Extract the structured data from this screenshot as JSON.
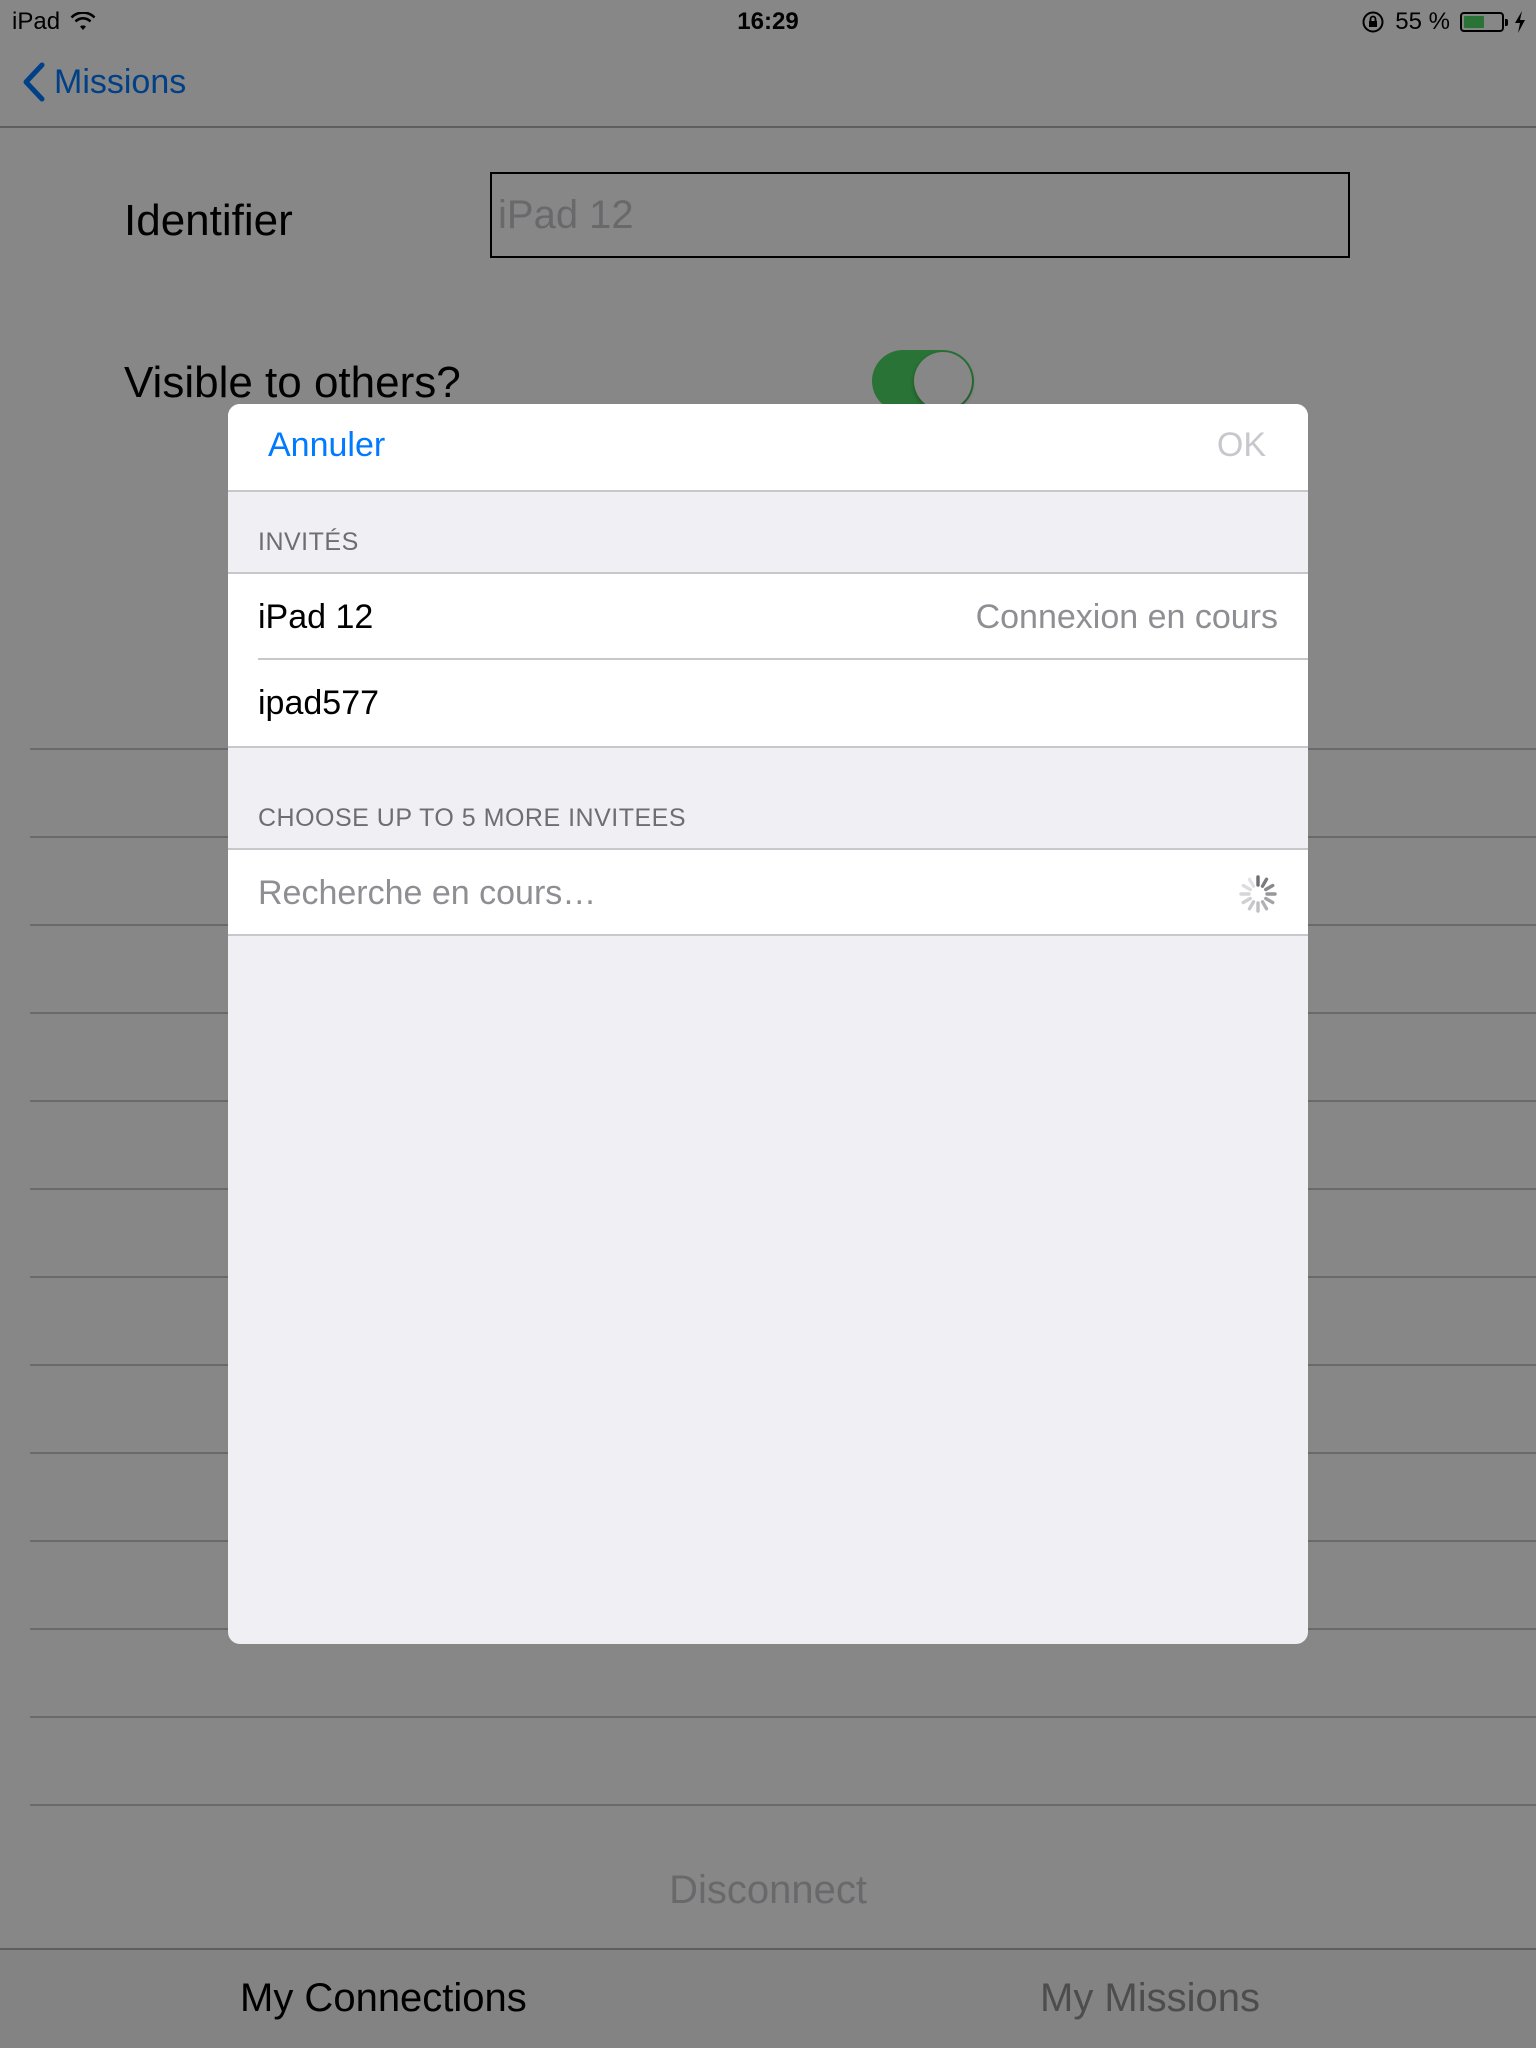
{
  "status_bar": {
    "device": "iPad",
    "time": "16:29",
    "battery_percent_label": "55 %",
    "battery_level": 0.55,
    "icons": [
      "wifi-icon",
      "rotation-lock-icon",
      "battery-icon",
      "charging-bolt-icon"
    ]
  },
  "nav": {
    "back_label": "Missions"
  },
  "form": {
    "identifier_label": "Identifier",
    "identifier_placeholder": "iPad 12",
    "visible_label": "Visible to others?",
    "visible_on": true
  },
  "disconnect_label": "Disconnect",
  "tabs": [
    {
      "label": "My Connections",
      "selected": true
    },
    {
      "label": "My Missions",
      "selected": false
    }
  ],
  "modal": {
    "cancel_label": "Annuler",
    "ok_label": "OK",
    "invited_header": "INVITÉS",
    "invited": [
      {
        "name": "iPad 12",
        "status": "Connexion en cours"
      },
      {
        "name": "ipad577",
        "status": ""
      }
    ],
    "choose_header": "CHOOSE UP TO 5 MORE INVITEES",
    "searching_label": "Recherche en cours…"
  },
  "colors": {
    "accent": "#007aff",
    "toggle_on": "#4cd964",
    "grouped_background": "#efeff4",
    "secondary_text": "#8e8e93"
  }
}
